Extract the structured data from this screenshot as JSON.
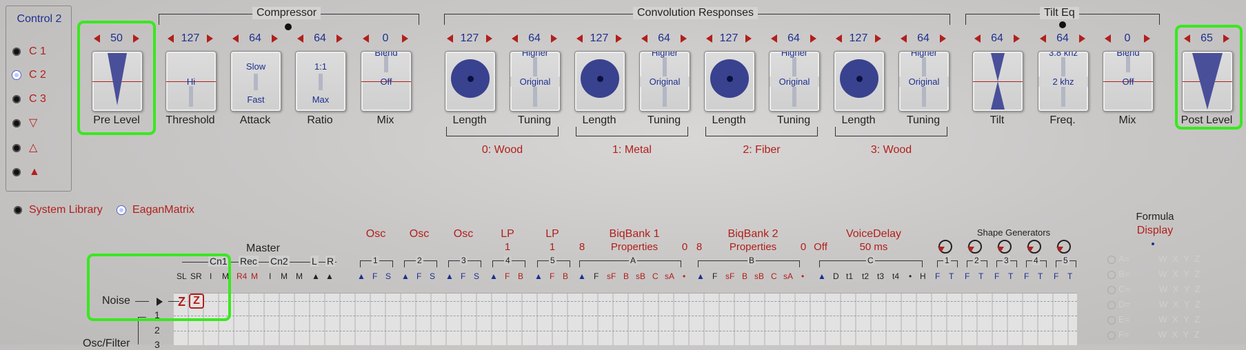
{
  "control_panel": {
    "title": "Control 2",
    "items": [
      {
        "label": "C 1",
        "selected": false
      },
      {
        "label": "C 2",
        "selected": true
      },
      {
        "label": "C 3",
        "selected": false
      },
      {
        "label": "▽",
        "selected": false
      },
      {
        "label": "△",
        "selected": false
      },
      {
        "label": "▲",
        "selected": false
      }
    ]
  },
  "groups": {
    "compressor": "Compressor",
    "convolution": "Convolution Responses",
    "tilt_eq": "Tilt Eq"
  },
  "knobs": {
    "pre_level": {
      "value": "50",
      "label": "Pre Level"
    },
    "threshold": {
      "value": "127",
      "label": "Threshold",
      "text": "Hi"
    },
    "attack": {
      "value": "64",
      "label": "Attack",
      "top": "Slow",
      "bottom": "Fast"
    },
    "ratio": {
      "value": "64",
      "label": "Ratio",
      "top": "1:1",
      "bottom": "Max"
    },
    "mix1": {
      "value": "0",
      "label": "Mix",
      "top": "Blend",
      "mid": "Off"
    },
    "len0": {
      "value": "127",
      "label": "Length"
    },
    "tun0": {
      "value": "64",
      "label": "Tuning",
      "top": "Higher",
      "mid": "Original"
    },
    "len1": {
      "value": "127",
      "label": "Length"
    },
    "tun1": {
      "value": "64",
      "label": "Tuning",
      "top": "Higher",
      "mid": "Original"
    },
    "len2": {
      "value": "127",
      "label": "Length"
    },
    "tun2": {
      "value": "64",
      "label": "Tuning",
      "top": "Higher",
      "mid": "Original"
    },
    "len3": {
      "value": "127",
      "label": "Length"
    },
    "tun3": {
      "value": "64",
      "label": "Tuning",
      "top": "Higher",
      "mid": "Original"
    },
    "tilt": {
      "value": "64",
      "label": "Tilt"
    },
    "freq": {
      "value": "64",
      "label": "Freq.",
      "top": "3.8 khz",
      "mid": "2 khz"
    },
    "mix2": {
      "value": "0",
      "label": "Mix",
      "top": "Blend",
      "mid": "Off"
    },
    "post_level": {
      "value": "65",
      "label": "Post Level"
    }
  },
  "conv_sublabels": [
    "0: Wood",
    "1: Metal",
    "2: Fiber",
    "3: Wood"
  ],
  "library": {
    "system": "System Library",
    "eagan": "EaganMatrix",
    "selected": "EaganMatrix"
  },
  "matrix": {
    "master": "Master",
    "master_groups": [
      "Cn1",
      "Rec",
      "Cn2",
      "L",
      "R"
    ],
    "master_letters": [
      "SL",
      "SR",
      "I",
      "M",
      "R4",
      "M",
      "I",
      "M",
      "M",
      "▲",
      "▲"
    ],
    "headers": [
      {
        "top": "Osc",
        "sub": ""
      },
      {
        "top": "Osc",
        "sub": ""
      },
      {
        "top": "Osc",
        "sub": ""
      },
      {
        "top": "LP",
        "sub": "1"
      },
      {
        "top": "LP",
        "sub": "1"
      }
    ],
    "num8a": "8",
    "biq1": {
      "title": "BiqBank 1",
      "sub": "Properties",
      "n": "0"
    },
    "num8b": "8",
    "biq2": {
      "title": "BiqBank 2",
      "sub": "Properties",
      "n": "0"
    },
    "off": "Off",
    "voice_delay": {
      "title": "VoiceDelay",
      "sub": "50 ms"
    },
    "shape_generators": "Shape Generators",
    "formula": {
      "title": "Formula",
      "display": "Display"
    },
    "group_numbers": [
      "1",
      "2",
      "3",
      "4",
      "5"
    ],
    "group_letters": [
      "A",
      "B",
      "C"
    ],
    "shape_numbers": [
      "1",
      "2",
      "3",
      "4",
      "5"
    ],
    "col_letters": {
      "osc": [
        "▲",
        "F",
        "S"
      ],
      "lp": [
        "▲",
        "F",
        "B"
      ],
      "biq": [
        "▲",
        "F",
        "sF",
        "B",
        "sB",
        "C",
        "sA",
        "•"
      ],
      "vd": [
        "▲",
        "D",
        "t1",
        "t2",
        "t3",
        "t4",
        "•",
        "H"
      ],
      "sg": [
        "F",
        "T"
      ]
    },
    "noise_label": "Noise",
    "osc_filter_label": "Osc/Filter",
    "row_numbers": [
      "1",
      "2",
      "3"
    ],
    "formula_rows": [
      "A=",
      "B=",
      "C=",
      "D=",
      "E=",
      "F="
    ],
    "formula_vars": "W X Y Z"
  }
}
